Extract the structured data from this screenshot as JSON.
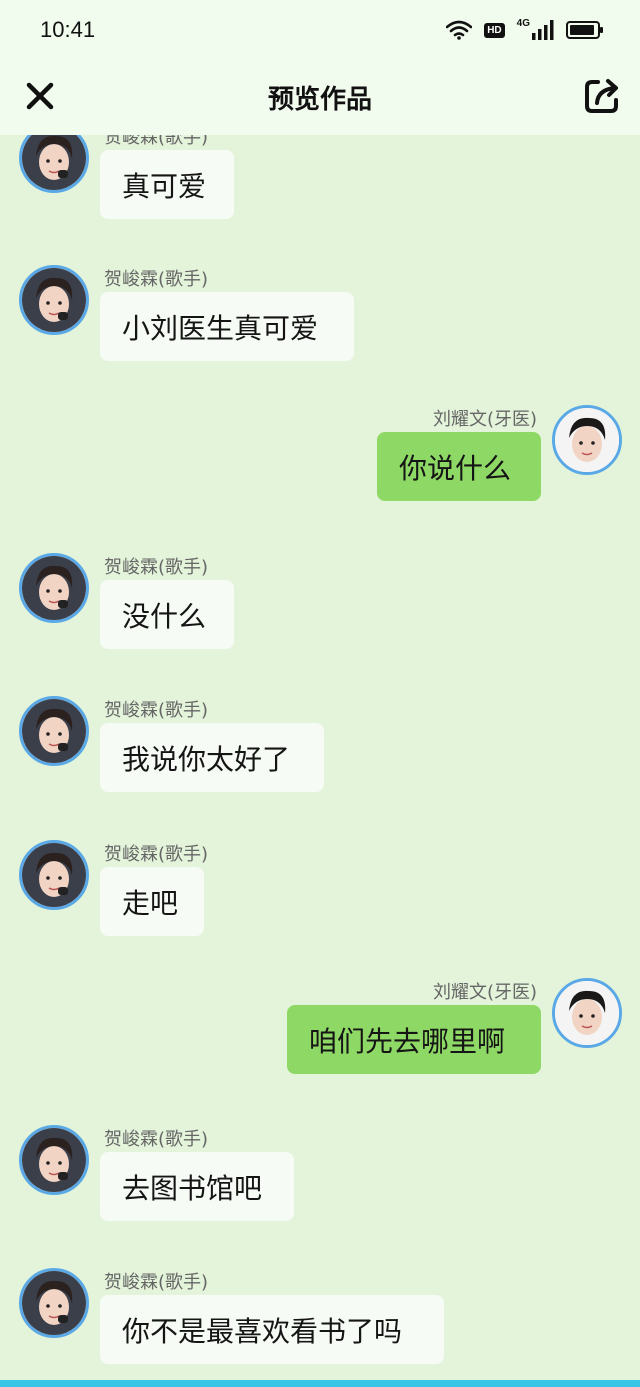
{
  "status_bar": {
    "time": "10:41",
    "hd": "HD",
    "network": "4G"
  },
  "header": {
    "title": "预览作品"
  },
  "colors": {
    "background": "#e3f4da",
    "self_bubble": "#8ed865",
    "other_bubble": "#f7fbf5",
    "avatar_border": "#5aa9e6"
  },
  "messages": [
    {
      "side": "left",
      "name": "贺峻霖(歌手)",
      "text": "真可爱"
    },
    {
      "side": "left",
      "name": "贺峻霖(歌手)",
      "text": "小刘医生真可爱"
    },
    {
      "side": "right",
      "name": "刘耀文(牙医)",
      "text": "你说什么"
    },
    {
      "side": "left",
      "name": "贺峻霖(歌手)",
      "text": "没什么"
    },
    {
      "side": "left",
      "name": "贺峻霖(歌手)",
      "text": "我说你太好了"
    },
    {
      "side": "left",
      "name": "贺峻霖(歌手)",
      "text": "走吧"
    },
    {
      "side": "right",
      "name": "刘耀文(牙医)",
      "text": "咱们先去哪里啊"
    },
    {
      "side": "left",
      "name": "贺峻霖(歌手)",
      "text": "去图书馆吧"
    },
    {
      "side": "left",
      "name": "贺峻霖(歌手)",
      "text": "你不是最喜欢看书了吗"
    }
  ]
}
